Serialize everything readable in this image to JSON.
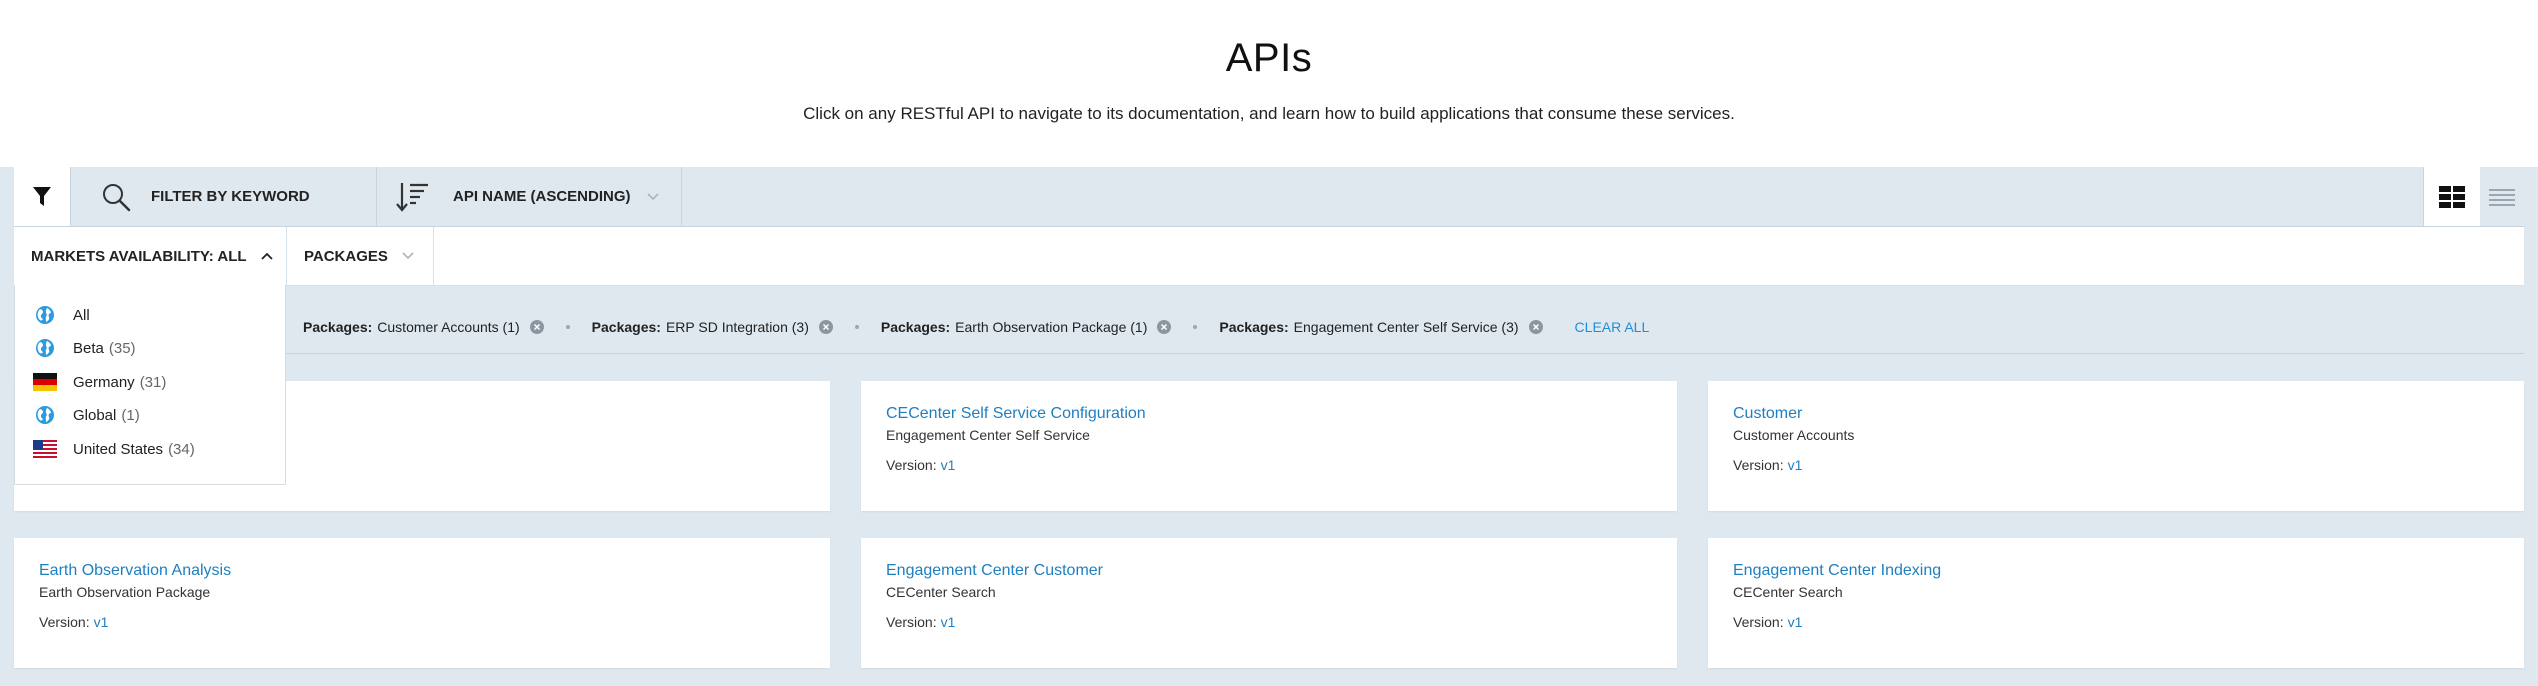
{
  "header": {
    "title": "APIs",
    "subtitle": "Click on any RESTful API to navigate to its documentation, and learn how to build applications that consume these services."
  },
  "toolbar": {
    "search_placeholder": "FILTER BY KEYWORD",
    "sort_label": "API NAME (ASCENDING)"
  },
  "filters": {
    "markets_label": "MARKETS AVAILABILITY: ALL",
    "packages_label": "PACKAGES"
  },
  "markets_dropdown": {
    "items": [
      {
        "label": "All",
        "count": "",
        "icon": "globe-icon"
      },
      {
        "label": "Beta",
        "count": "(35)",
        "icon": "globe-icon"
      },
      {
        "label": "Germany",
        "count": "(31)",
        "icon": "flag-germany-icon"
      },
      {
        "label": "Global",
        "count": "(1)",
        "icon": "globe-icon"
      },
      {
        "label": "United States",
        "count": "(34)",
        "icon": "flag-us-icon"
      }
    ]
  },
  "active_filters": {
    "chips": [
      {
        "key": "Packages:",
        "value": "Customer Accounts (1)"
      },
      {
        "key": "Packages:",
        "value": "ERP SD Integration (3)"
      },
      {
        "key": "Packages:",
        "value": "Earth Observation Package (1)"
      },
      {
        "key": "Packages:",
        "value": "Engagement Center Self Service (3)"
      }
    ],
    "clear_all": "CLEAR ALL"
  },
  "cards": [
    {
      "name": "CECenter Self Service Configuration",
      "package": "Engagement Center Self Service",
      "version_label": "Version:",
      "version": "v1"
    },
    {
      "name": "Customer",
      "package": "Customer Accounts",
      "version_label": "Version:",
      "version": "v1"
    },
    {
      "name": "Earth Observation Analysis",
      "package": "Earth Observation Package",
      "version_label": "Version:",
      "version": "v1"
    },
    {
      "name": "Engagement Center Customer",
      "package": "CECenter Search",
      "version_label": "Version:",
      "version": "v1"
    },
    {
      "name": "Engagement Center Indexing",
      "package": "CECenter Search",
      "version_label": "Version:",
      "version": "v1"
    }
  ],
  "colors": {
    "link": "#1e7fc1",
    "background": "#dfe8ef"
  }
}
